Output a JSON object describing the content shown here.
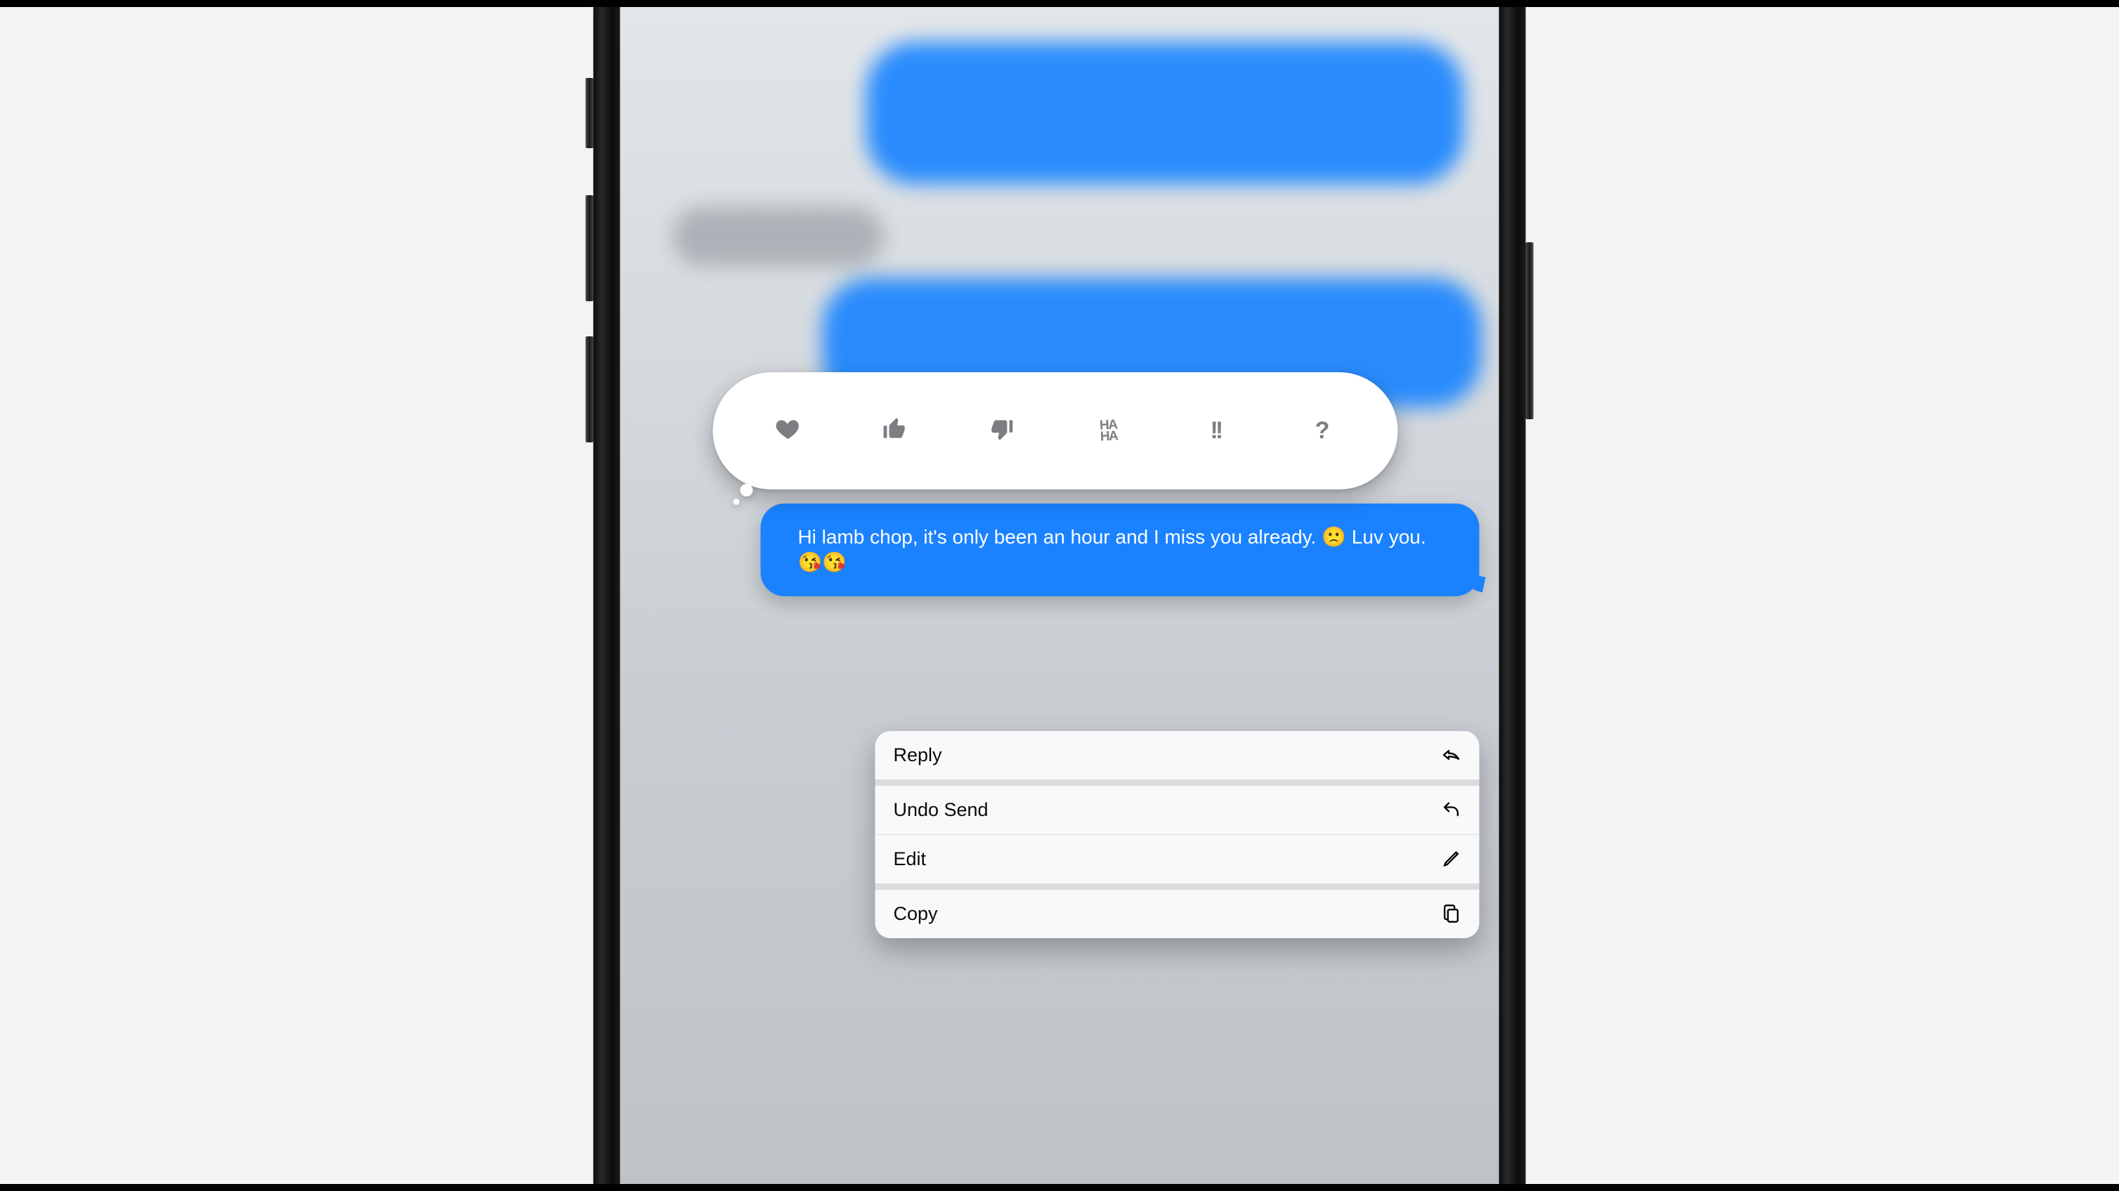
{
  "message": {
    "text_before_frown": "Hi lamb chop, it's only been an hour and I miss you already.",
    "frown_emoji": "🙁",
    "text_mid": "Luv you.",
    "kiss_emoji_1": "😘",
    "kiss_emoji_2": "😘"
  },
  "tapback": {
    "heart_name": "heart",
    "thumbs_up_name": "thumbs-up",
    "thumbs_down_name": "thumbs-down",
    "haha_top": "HA",
    "haha_bottom": "HA",
    "exclaim": "!!",
    "question": "?"
  },
  "menu": {
    "reply": "Reply",
    "undo_send": "Undo Send",
    "edit": "Edit",
    "copy": "Copy"
  }
}
